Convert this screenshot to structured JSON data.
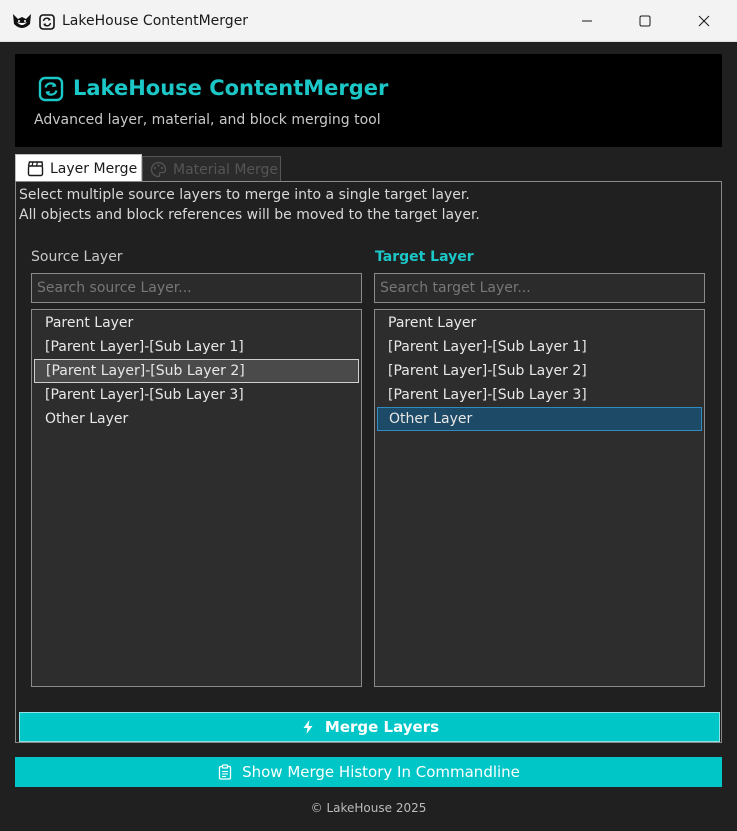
{
  "window": {
    "title": "LakeHouse ContentMerger"
  },
  "header": {
    "title": "LakeHouse ContentMerger",
    "subtitle": "Advanced layer, material, and block merging tool"
  },
  "tabs": [
    {
      "label": "Layer Merge",
      "active": true
    },
    {
      "label": "Material Merge",
      "active": false
    }
  ],
  "instructions": {
    "line1": "Select multiple source layers to merge into a single target layer.",
    "line2": "All objects and block references will be moved to the target layer."
  },
  "source": {
    "label": "Source Layer",
    "placeholder": "Search source Layer...",
    "items": [
      "Parent Layer",
      "[Parent Layer]-[Sub Layer 1]",
      "[Parent Layer]-[Sub Layer 2]",
      "[Parent Layer]-[Sub Layer 3]",
      "Other Layer"
    ],
    "selected_index": 2
  },
  "target": {
    "label": "Target Layer",
    "placeholder": "Search target Layer...",
    "items": [
      "Parent Layer",
      "[Parent Layer]-[Sub Layer 1]",
      "[Parent Layer]-[Sub Layer 2]",
      "[Parent Layer]-[Sub Layer 3]",
      "Other Layer"
    ],
    "selected_index": 4
  },
  "buttons": {
    "merge_label": "Merge Layers",
    "history_label": "Show Merge History In Commandline"
  },
  "footer": {
    "text": "© LakeHouse 2025"
  },
  "colors": {
    "accent": "#00c6c8",
    "accent_text": "#1cc7c8"
  },
  "icons": {
    "app": "cat-logo-icon",
    "header": "sync-icon",
    "layer_tab": "clapperboard-icon",
    "material_tab": "palette-icon",
    "merge": "lightning-icon",
    "history": "clipboard-icon"
  }
}
